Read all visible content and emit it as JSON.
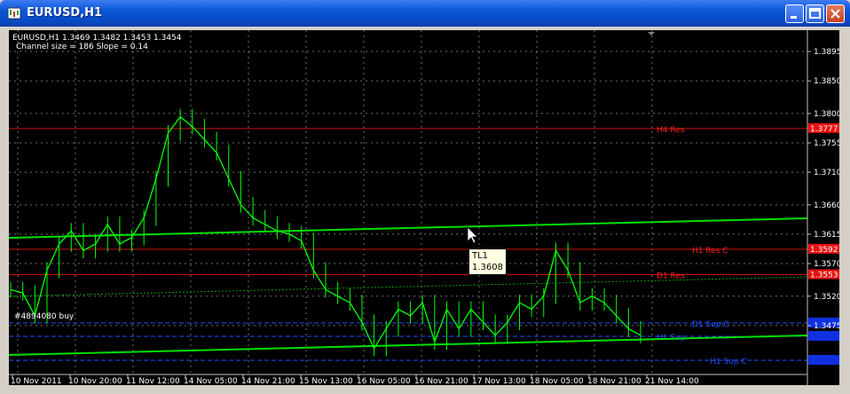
{
  "window": {
    "title": "EURUSD,H1"
  },
  "chart": {
    "header_line": "EURUSD,H1  1.3469 1.3482 1.3453 1.3454",
    "channel_info": "Channel size = 186 Slope = 0.14",
    "order_label": "#4894080 buy",
    "price_ticks": [
      "1.3895",
      "1.3850",
      "1.3800",
      "1.3755",
      "1.3710",
      "1.3660",
      "1.3615",
      "1.3570",
      "1.3520",
      "1.3475"
    ],
    "time_ticks": [
      "10 Nov 2011",
      "10 Nov 20:00",
      "11 Nov 12:00",
      "14 Nov 05:00",
      "14 Nov 21:00",
      "15 Nov 13:00",
      "16 Nov 05:00",
      "16 Nov 21:00",
      "17 Nov 13:00",
      "18 Nov 05:00",
      "18 Nov 21:00",
      "21 Nov 14:00"
    ],
    "levels": [
      {
        "name": "H4 Res",
        "price_label": "1.3777",
        "color": "#ff2020"
      },
      {
        "name": "H1 Res C",
        "price_label": "1.3592",
        "color": "#ff2020"
      },
      {
        "name": "D1 Res",
        "price_label": "1.3553",
        "color": "#ff2020"
      },
      {
        "name": "D1 Sup C",
        "price_label": "",
        "color": "#2050ff"
      },
      {
        "name": "H1 Sup",
        "price_label": "",
        "color": "#2050ff"
      },
      {
        "name": "H1 Sup C",
        "price_label": "",
        "color": "#2050ff"
      }
    ],
    "tooltip": {
      "name": "TL1",
      "value": "1.3608"
    },
    "colors": {
      "background": "#000000",
      "candles": "#00ff00",
      "trendline": "#00ff00",
      "grid": "#808080"
    }
  },
  "chart_data": {
    "type": "line",
    "title": "EURUSD,H1",
    "subtitle": "EURUSD,H1  1.3469 1.3482 1.3453 1.3454",
    "xlabel": "",
    "ylabel": "",
    "ylim": [
      1.34,
      1.3925
    ],
    "x_categories": [
      "10 Nov 2011",
      "10 Nov 20:00",
      "11 Nov 12:00",
      "14 Nov 05:00",
      "14 Nov 21:00",
      "15 Nov 13:00",
      "16 Nov 05:00",
      "16 Nov 21:00",
      "17 Nov 13:00",
      "18 Nov 05:00",
      "18 Nov 21:00",
      "21 Nov 14:00"
    ],
    "series": [
      {
        "values": [
          1.353,
          1.3525,
          1.349,
          1.356,
          1.36,
          1.362,
          1.359,
          1.36,
          1.363,
          1.36,
          1.361,
          1.364,
          1.37,
          1.377,
          1.3795,
          1.378,
          1.376,
          1.374,
          1.37,
          1.366,
          1.364,
          1.363,
          1.362,
          1.3615,
          1.3605,
          1.356,
          1.353,
          1.352,
          1.351,
          1.348,
          1.344,
          1.347,
          1.35,
          1.349,
          1.351,
          1.345,
          1.35,
          1.347,
          1.35,
          1.348,
          1.346,
          1.348,
          1.351,
          1.35,
          1.352,
          1.359,
          1.356,
          1.351,
          1.352,
          1.351,
          1.349,
          1.347,
          1.346
        ]
      }
    ],
    "horizontal_levels": [
      {
        "name": "H4 Res",
        "value": 1.3777
      },
      {
        "name": "H1 Res C",
        "value": 1.3592
      },
      {
        "name": "D1 Res",
        "value": 1.3553
      }
    ],
    "trendlines": [
      {
        "name": "TL1",
        "value": 1.3608
      }
    ]
  }
}
